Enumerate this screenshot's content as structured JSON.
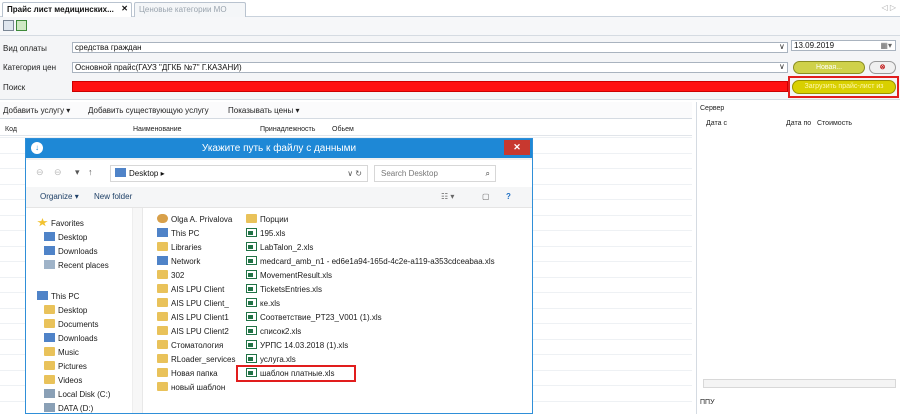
{
  "tabs": [
    {
      "label": "Прайс лист медицинских..."
    },
    {
      "label": "Ценовые категории МО"
    }
  ],
  "form": {
    "payment_label": "Вид оплаты",
    "payment_value": "средства граждан",
    "category_label": "Категория цен",
    "category_value": "Основной прайс(ГАУЗ \"ДГКБ №7\" Г.КАЗАНИ)",
    "search_label": "Поиск",
    "date": "13.09.2019",
    "new_button": "Новая...",
    "upload_button": "Загрузить прайс-лист из"
  },
  "toolbar": {
    "add_service": "Добавить услугу",
    "add_existing": "Добавить существующую услугу",
    "show_prices": "Показывать цены"
  },
  "grid": {
    "columns": [
      "Код",
      "Наименование",
      "Принадлежность",
      "Обьем"
    ]
  },
  "right": {
    "section1": "Сервер",
    "columns": [
      "Дата с",
      "Дата по",
      "Стоимость"
    ],
    "section2": "ППУ"
  },
  "dialog": {
    "title": "Укажите путь к файлу с данными",
    "address": "Desktop",
    "search_placeholder": "Search Desktop",
    "organize": "Organize",
    "new_folder": "New folder",
    "nav_items": [
      "Favorites",
      "Desktop",
      "Downloads",
      "Recent places",
      "This PC",
      "Desktop",
      "Documents",
      "Downloads",
      "Music",
      "Pictures",
      "Videos",
      "Local Disk (C:)",
      "DATA (D:)"
    ],
    "col1": [
      "Olga A. Privalova",
      "This PC",
      "Libraries",
      "Network",
      "302",
      "AIS LPU Client",
      "AIS LPU Client_",
      "AIS LPU Client1",
      "AIS LPU Client2",
      "Стоматология",
      "RLoader_services",
      "Новая папка",
      "новый шаблон"
    ],
    "col2": [
      "Порции",
      "195.xls",
      "LabTalon_2.xls",
      "medcard_amb_n1 - ed6e1a94-165d-4c2e-a119-a353cdceabaa.xls",
      "MovementResult.xls",
      "TicketsEntries.xls",
      "ке.xls",
      "Соответствие_PT23_V001 (1).xls",
      "список2.xls",
      "УРПС 14.03.2018 (1).xls",
      "услуга.xls",
      "шаблон платные.xls"
    ]
  },
  "colors": {
    "accent": "#1e88d6",
    "highlight": "#e11d1d",
    "red_field": "#ff1111",
    "yellow_btn": "#d9d000"
  }
}
